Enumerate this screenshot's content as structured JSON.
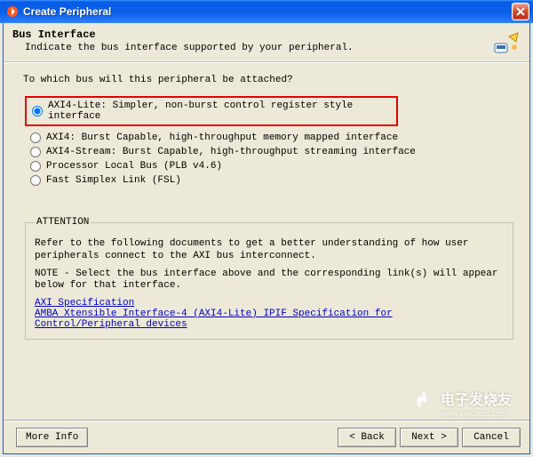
{
  "window": {
    "title": "Create Peripheral"
  },
  "header": {
    "title": "Bus Interface",
    "subtitle": "Indicate the bus interface supported by your peripheral."
  },
  "question": "To which bus will this peripheral be attached?",
  "options": [
    {
      "label": "AXI4-Lite: Simpler, non-burst control register style interface",
      "selected": true,
      "highlighted": true
    },
    {
      "label": "AXI4: Burst Capable, high-throughput memory mapped interface",
      "selected": false,
      "highlighted": false
    },
    {
      "label": "AXI4-Stream: Burst Capable, high-throughput streaming interface",
      "selected": false,
      "highlighted": false
    },
    {
      "label": "Processor Local Bus (PLB v4.6)",
      "selected": false,
      "highlighted": false
    },
    {
      "label": "Fast Simplex Link (FSL)",
      "selected": false,
      "highlighted": false
    }
  ],
  "attention": {
    "legend": "ATTENTION",
    "para1": "Refer to the following documents to get a better understanding of how user peripherals connect to the AXI bus interconnect.",
    "para2": "NOTE - Select the bus interface above and the corresponding link(s) will appear below for that interface.",
    "links": [
      "AXI Specification",
      "AMBA Xtensible Interface-4 (AXI4-Lite) IPIF Specification for Control/Peripheral devices"
    ]
  },
  "footer": {
    "more_info": "More Info",
    "back": "< Back",
    "next": "Next >",
    "cancel": "Cancel"
  },
  "watermark": {
    "line1": "电子发烧友",
    "line2": "www.elecfans.com"
  }
}
